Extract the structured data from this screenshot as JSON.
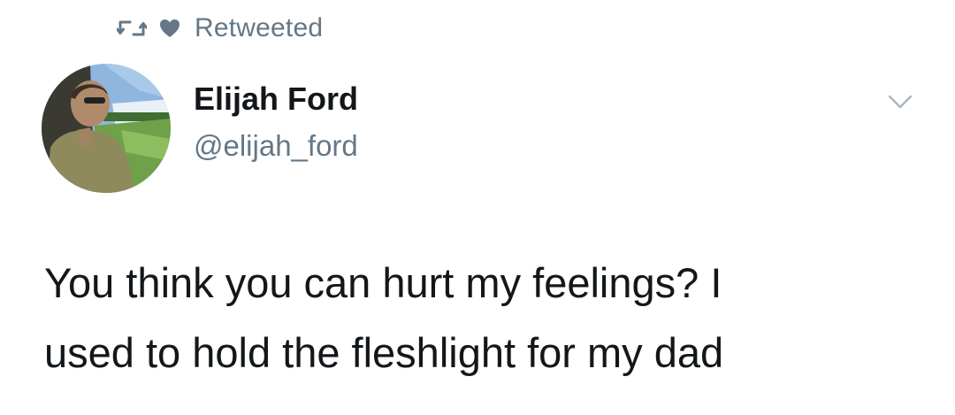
{
  "social_context": {
    "text": "Retweeted",
    "icons": [
      "retweet-icon",
      "heart-icon"
    ],
    "color": "#657786"
  },
  "author": {
    "name": "Elijah Ford",
    "handle": "@elijah_ford"
  },
  "menu": {
    "icon": "chevron-down-icon"
  },
  "tweet": {
    "text": "You think you can hurt my feelings? I\nused to hold the fleshlight for my dad"
  },
  "colors": {
    "text_primary": "#14171a",
    "text_secondary": "#657786",
    "background": "#ffffff"
  }
}
